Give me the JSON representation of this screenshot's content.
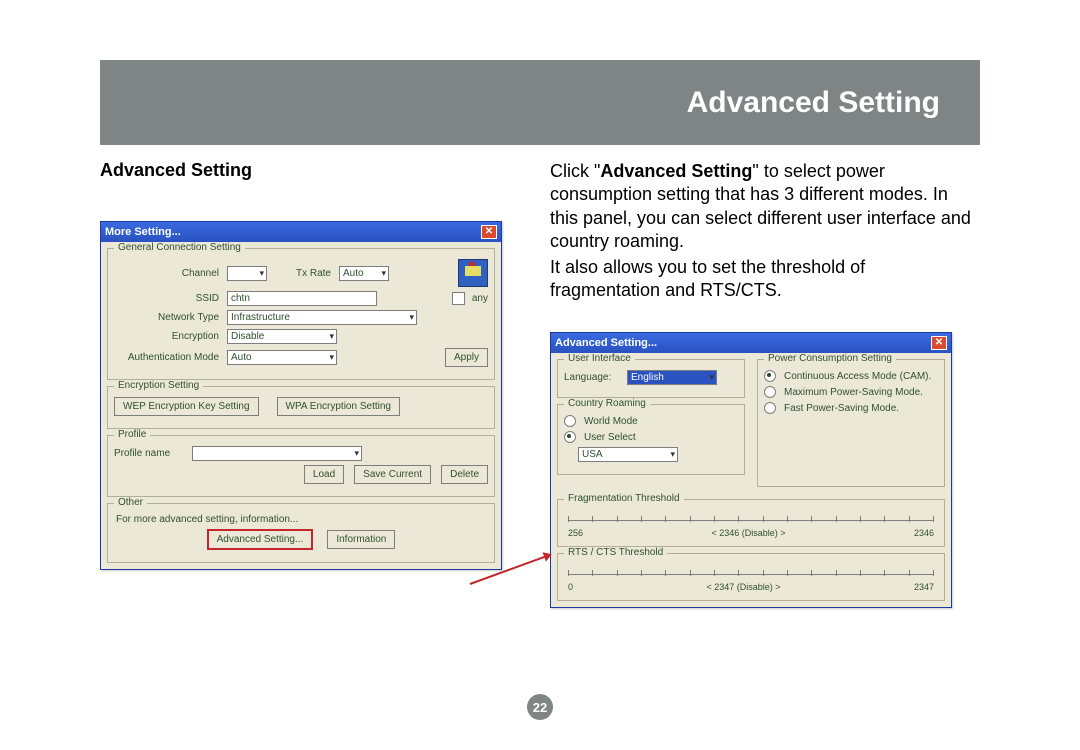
{
  "header": {
    "title": "Advanced Setting"
  },
  "left_title": "Advanced Setting",
  "desc_lines": [
    "Click \"",
    "Advanced Setting",
    "\" to select power consumption setting that has 3 different modes. In this panel, you can select different user interface and country roaming.",
    "It also also allows you to set the threshold of fragmentation and RTS/CTS."
  ],
  "desc_p1_pre": "Click \"",
  "desc_p1_bold": "Advanced Setting",
  "desc_p1_post": "\" to select power consumption setting that has 3 different modes. In this panel, you can select different user interface and country roaming.",
  "desc_p2": "It also allows you to set the threshold of fragmentation and RTS/CTS.",
  "page_num": "22",
  "dlg1": {
    "title": "More Setting...",
    "close": "✕",
    "g_general": "General Connection Setting",
    "channel_lbl": "Channel",
    "txrate_lbl": "Tx Rate",
    "txrate_val": "Auto",
    "ssid_lbl": "SSID",
    "ssid_val": "chtn",
    "any_lbl": "any",
    "nettype_lbl": "Network Type",
    "nettype_val": "Infrastructure",
    "enc_lbl": "Encryption",
    "enc_val": "Disable",
    "auth_lbl": "Authentication Mode",
    "auth_val": "Auto",
    "apply": "Apply",
    "g_encset": "Encryption Setting",
    "wep_btn": "WEP Encryption Key Setting",
    "wpa_btn": "WPA Encryption Setting",
    "g_profile": "Profile",
    "profname_lbl": "Profile name",
    "load": "Load",
    "save": "Save Current",
    "delete": "Delete",
    "g_other": "Other",
    "other_txt": "For more advanced setting, information...",
    "adv_btn": "Advanced Setting...",
    "info_btn": "Information"
  },
  "dlg2": {
    "title": "Advanced Setting...",
    "close": "✕",
    "g_ui": "User Interface",
    "lang_lbl": "Language:",
    "lang_val": "English",
    "g_power": "Power Consumption Setting",
    "p1": "Continuous Access Mode (CAM).",
    "p2": "Maximum Power-Saving Mode.",
    "p3": "Fast Power-Saving Mode.",
    "g_roam": "Country Roaming",
    "r1": "World Mode",
    "r2": "User Select",
    "country_val": "USA",
    "g_frag": "Fragmentation Threshold",
    "frag_min": "256",
    "frag_val": "< 2346 (Disable) >",
    "frag_max": "2346",
    "g_rts": "RTS / CTS Threshold",
    "rts_min": "0",
    "rts_val": "< 2347 (Disable) >",
    "rts_max": "2347"
  }
}
